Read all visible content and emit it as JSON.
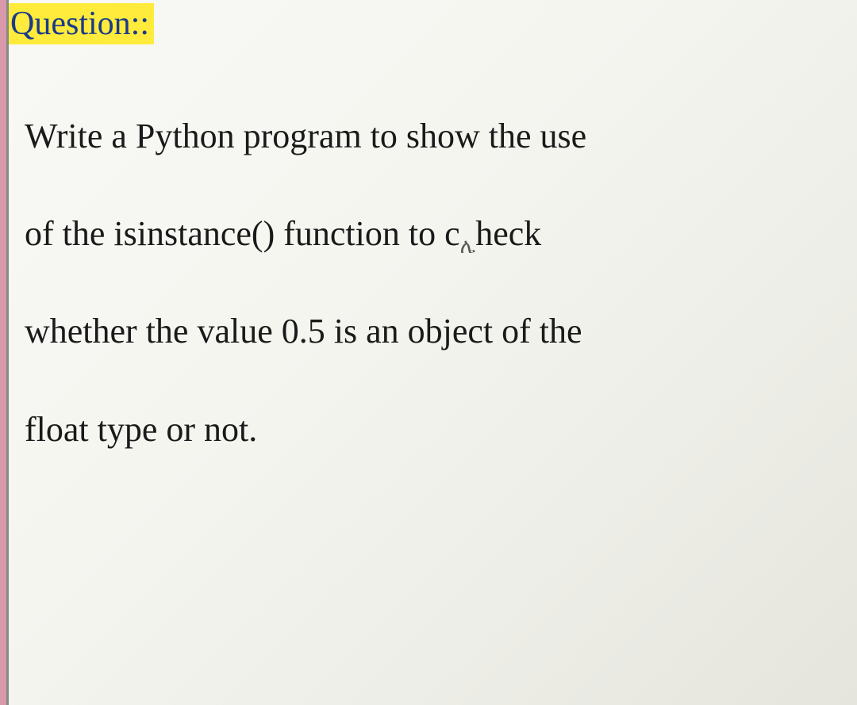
{
  "label": "Question::",
  "body": {
    "line1": "Write a Python program to show the use",
    "line2_a": "of the isinstance() function to c",
    "line2_b": "heck",
    "line3": "whether the value 0.5 is an object of the",
    "line4": "float type or not."
  }
}
